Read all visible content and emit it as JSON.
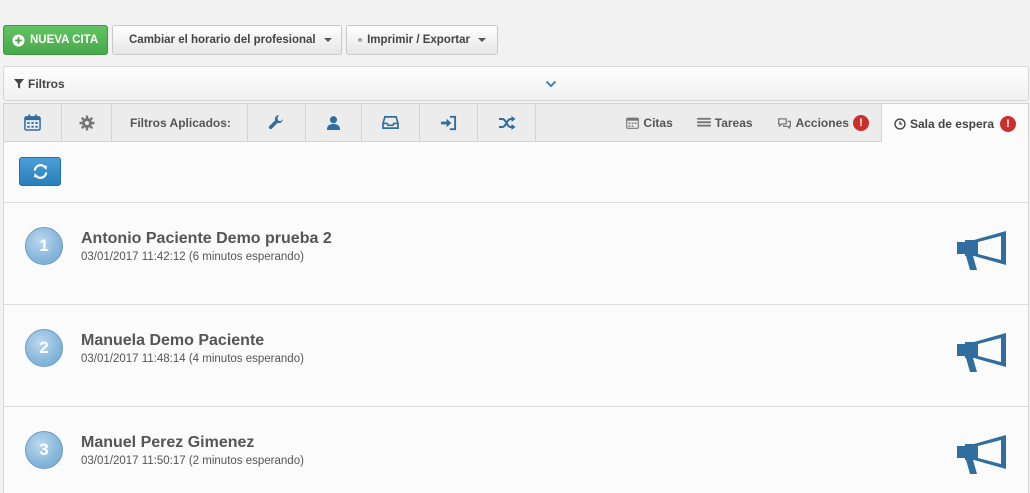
{
  "toolbar": {
    "new_appointment": "NUEVA CITA",
    "change_schedule": "Cambiar el horario del profesional",
    "print_export": "Imprimir / Exportar"
  },
  "filters": {
    "label": "Filtros"
  },
  "tabs": {
    "applied_filters_label": "Filtros Aplicados:",
    "right": [
      {
        "label": "Citas",
        "icon": "calendar-icon"
      },
      {
        "label": "Tareas",
        "icon": "list-icon"
      },
      {
        "label": "Acciones",
        "icon": "comments-icon",
        "badge": "!"
      },
      {
        "label": "Sala de espera",
        "icon": "clock-icon",
        "badge": "!",
        "active": true
      }
    ]
  },
  "waiting_room": {
    "patients": [
      {
        "number": "1",
        "name": "Antonio Paciente Demo prueba 2",
        "arrival": "03/01/2017 11:42:12 (6 minutos esperando)"
      },
      {
        "number": "2",
        "name": "Manuela Demo Paciente",
        "arrival": "03/01/2017 11:48:14 (4 minutos esperando)"
      },
      {
        "number": "3",
        "name": "Manuel Perez Gimenez",
        "arrival": "03/01/2017 11:50:17 (2 minutos esperando)"
      }
    ]
  },
  "colors": {
    "accent": "#2a7fb8",
    "success": "#4aa84a",
    "danger": "#c9302c",
    "icon": "#2f6e9e"
  }
}
